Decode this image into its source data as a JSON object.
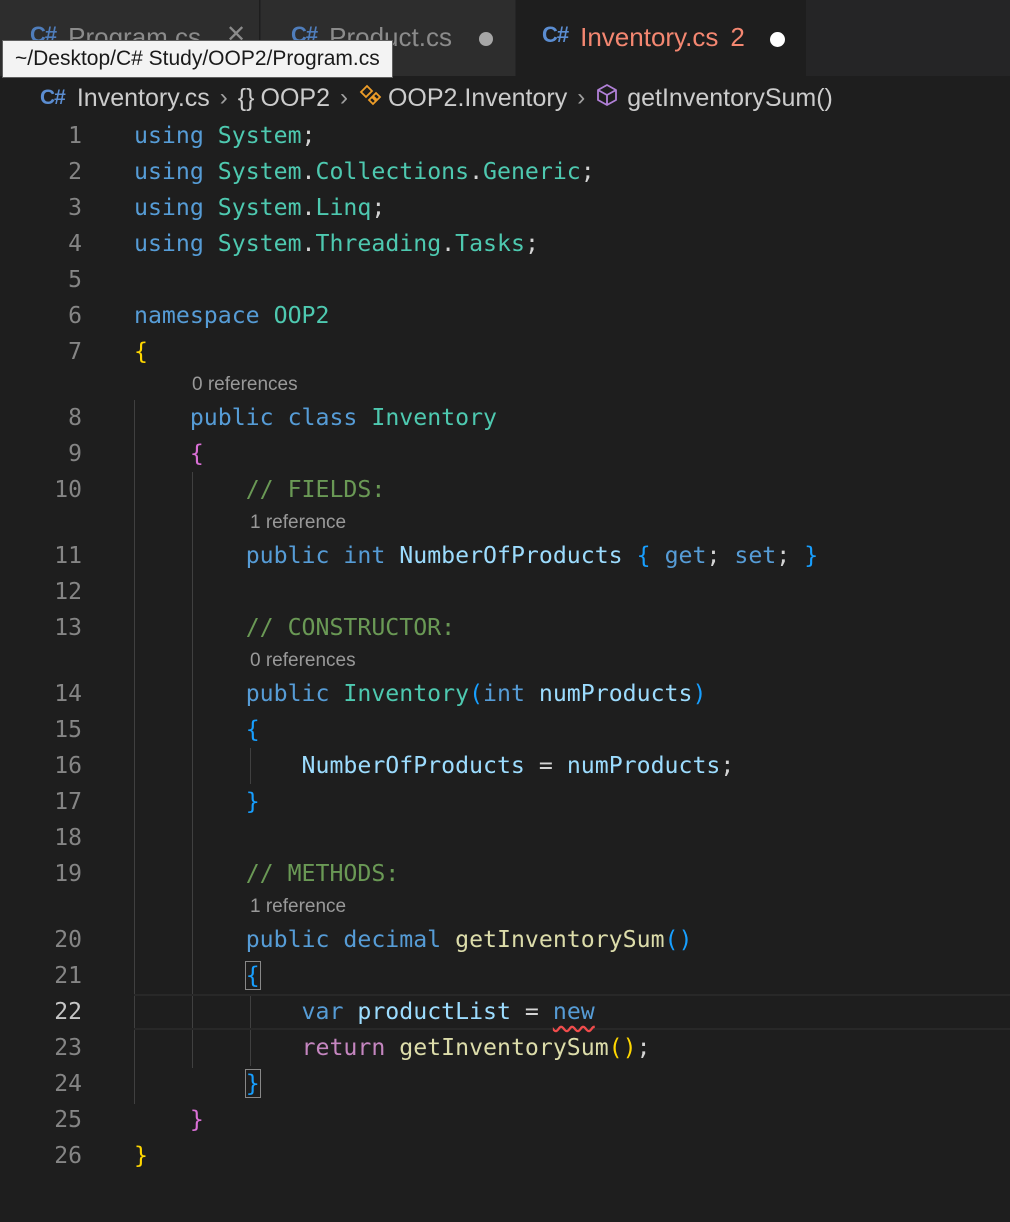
{
  "tabs": [
    {
      "icon": "C#",
      "label": "Program.cs"
    },
    {
      "icon": "C#",
      "label": "Product.cs"
    },
    {
      "icon": "C#",
      "label": "Inventory.cs",
      "problems": "2"
    }
  ],
  "tooltip": "~/Desktop/C# Study/OOP2/Program.cs",
  "breadcrumb": {
    "file_icon": "C#",
    "file": "Inventory.cs",
    "namespace_icon": "{}",
    "namespace": "OOP2",
    "class": "OOP2.Inventory",
    "method": "getInventorySum()"
  },
  "icons": {
    "file": "csharp-file-icon",
    "close": "close-icon",
    "dirty": "unsaved-dot-icon",
    "separator": "chevron-right-icon",
    "namespace": "namespace-braces-icon",
    "class": "class-icon",
    "method": "method-cube-icon"
  },
  "colors": {
    "error_tab": "#f48771",
    "keyword": "#569cd6",
    "type": "#4ec9b0",
    "comment": "#6a9955",
    "function": "#dcdcaa"
  },
  "code_lens": {
    "ref0": "0 references",
    "ref1": "1 reference"
  },
  "line_numbers": [
    "1",
    "2",
    "3",
    "4",
    "5",
    "6",
    "7",
    "8",
    "9",
    "10",
    "11",
    "12",
    "13",
    "14",
    "15",
    "16",
    "17",
    "18",
    "19",
    "20",
    "21",
    "22",
    "23",
    "24",
    "25",
    "26"
  ],
  "code": {
    "l1": {
      "kw": "using",
      "ns": "System",
      "end": ";"
    },
    "l2": {
      "kw": "using",
      "ns1": "System",
      "ns2": "Collections",
      "ns3": "Generic",
      "end": ";"
    },
    "l3": {
      "kw": "using",
      "ns1": "System",
      "ns2": "Linq",
      "end": ";"
    },
    "l4": {
      "kw": "using",
      "ns1": "System",
      "ns2": "Threading",
      "ns3": "Tasks",
      "end": ";"
    },
    "l6": {
      "kw": "namespace",
      "ns": "OOP2"
    },
    "l7": {
      "brace": "{"
    },
    "l8": {
      "kw1": "public",
      "kw2": "class",
      "type": "Inventory"
    },
    "l9": {
      "brace": "{"
    },
    "l10": {
      "comment": "// FIELDS:"
    },
    "l11": {
      "kw1": "public",
      "kw2": "int",
      "prop": "NumberOfProducts",
      "open": "{",
      "get": "get",
      "set": "set",
      "close": "}"
    },
    "l13": {
      "comment": "// CONSTRUCTOR:"
    },
    "l14": {
      "kw": "public",
      "type": "Inventory",
      "open": "(",
      "param_type": "int",
      "param": "numProducts",
      "close": ")"
    },
    "l15": {
      "brace": "{"
    },
    "l16": {
      "prop": "NumberOfProducts",
      "op": "=",
      "value": "numProducts",
      "end": ";"
    },
    "l17": {
      "brace": "}"
    },
    "l19": {
      "comment": "// METHODS:"
    },
    "l20": {
      "kw1": "public",
      "kw2": "decimal",
      "fn": "getInventorySum",
      "parens": "()"
    },
    "l21": {
      "brace": "{"
    },
    "l22": {
      "kw": "var",
      "var": "productList",
      "op": "=",
      "new": "new"
    },
    "l23": {
      "ret": "return",
      "fn": "getInventorySum",
      "parens": "()",
      "end": ";"
    },
    "l24": {
      "brace": "}"
    },
    "l25": {
      "brace": "}"
    },
    "l26": {
      "brace": "}"
    }
  }
}
